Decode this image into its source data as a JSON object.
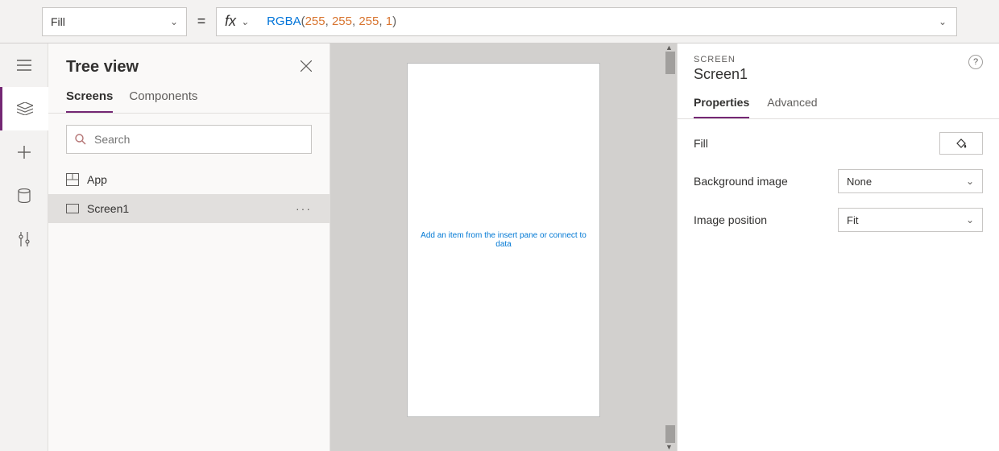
{
  "formula_bar": {
    "property": "Fill",
    "equals": "=",
    "fx_label": "fx",
    "tokens": {
      "fn": "RGBA",
      "open": "(",
      "n1": "255",
      "c1": ", ",
      "n2": "255",
      "c2": ", ",
      "n3": "255",
      "c3": ", ",
      "n4": "1",
      "close": ")"
    }
  },
  "tree_view": {
    "title": "Tree view",
    "tabs": {
      "screens": "Screens",
      "components": "Components"
    },
    "search_placeholder": "Search",
    "items": [
      {
        "label": "App"
      },
      {
        "label": "Screen1"
      }
    ]
  },
  "canvas": {
    "hint": "Add an item from the insert pane or connect to data"
  },
  "props": {
    "type_label": "SCREEN",
    "name": "Screen1",
    "tabs": {
      "properties": "Properties",
      "advanced": "Advanced"
    },
    "rows": {
      "fill": {
        "label": "Fill"
      },
      "bg": {
        "label": "Background image",
        "value": "None"
      },
      "pos": {
        "label": "Image position",
        "value": "Fit"
      }
    }
  }
}
